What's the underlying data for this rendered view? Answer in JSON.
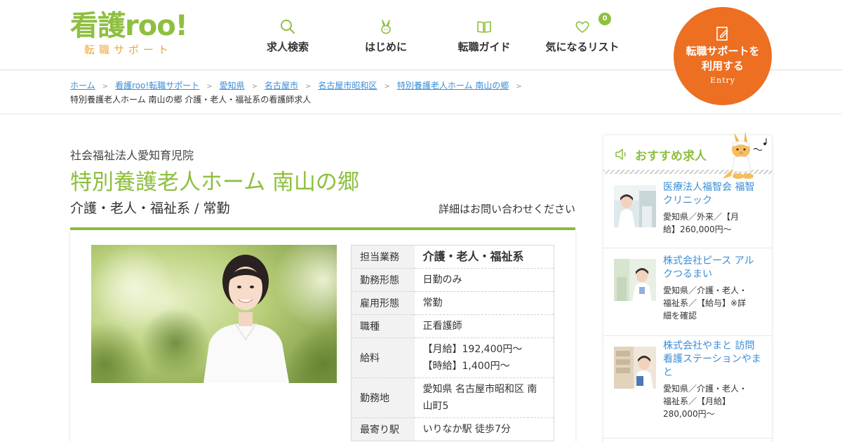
{
  "header": {
    "logo_main": "看護roo!",
    "logo_sub": "転職サポート",
    "nav": [
      {
        "label": "求人検索",
        "icon": "search-icon"
      },
      {
        "label": "はじめに",
        "icon": "rabbit-icon"
      },
      {
        "label": "転職ガイド",
        "icon": "book-icon"
      },
      {
        "label": "気になるリスト",
        "icon": "heart-icon",
        "badge": "0"
      }
    ],
    "entry": {
      "label_line1": "転職サポートを",
      "label_line2": "利用する",
      "sub": "Entry"
    }
  },
  "breadcrumb": {
    "links": [
      "ホーム",
      "看護roo!転職サポート",
      "愛知県",
      "名古屋市",
      "名古屋市昭和区",
      "特別養護老人ホーム 南山の郷"
    ],
    "separator": ">",
    "current": "特別養護老人ホーム 南山の郷 介護・老人・福祉系の看護師求人"
  },
  "job": {
    "organization": "社会福祉法人愛知育児院",
    "title": "特別養護老人ホーム 南山の郷",
    "subtitle": "介護・老人・福祉系 / 常勤",
    "detail_note": "詳細はお問い合わせください",
    "info": [
      {
        "label": "担当業務",
        "value": "介護・老人・福祉系"
      },
      {
        "label": "勤務形態",
        "value": "日勤のみ"
      },
      {
        "label": "雇用形態",
        "value": "常勤"
      },
      {
        "label": "職種",
        "value": "正看護師"
      },
      {
        "label": "給料",
        "value_line1": "【月給】192,400円～",
        "value_line2": "【時給】1,400円～"
      },
      {
        "label": "勤務地",
        "value_line1": "愛知県 名古屋市昭和区 南",
        "value_line2": "山町5"
      },
      {
        "label": "最寄り駅",
        "value": "いりなか駅 徒歩7分"
      }
    ]
  },
  "sidebar": {
    "title": "おすすめ求人",
    "items": [
      {
        "name_line1": "医療法人福智会 福智",
        "name_line2": "クリニック",
        "desc_line1": "愛知県／外来／【月",
        "desc_line2": "給】260,000円〜"
      },
      {
        "name_line1": "株式会社ピース アル",
        "name_line2": "クつるまい",
        "desc_line1": "愛知県／介護・老人・",
        "desc_line2": "福祉系／【給与】※詳",
        "desc_line3": "細を確認"
      },
      {
        "name_line1": "株式会社やまと 訪問",
        "name_line2": "看護ステーションやま",
        "name_line3": "と",
        "desc_line1": "愛知県／介護・老人・",
        "desc_line2": "福祉系／【月給】",
        "desc_line3": "280,000円〜"
      }
    ]
  },
  "colors": {
    "brand_green": "#8ebf3f",
    "entry_orange": "#ec6f22",
    "link_blue": "#3a8ed8",
    "logo_orange": "#f0a53a"
  }
}
